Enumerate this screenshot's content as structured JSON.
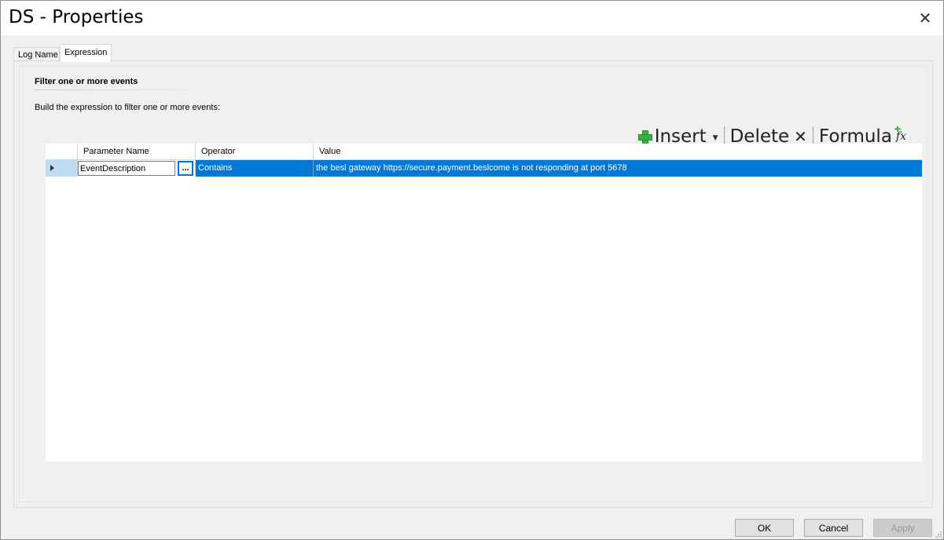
{
  "window": {
    "title": "DS - Properties",
    "close_glyph": "✕"
  },
  "tabs": [
    {
      "label": "Log Name",
      "active": false
    },
    {
      "label": "Expression",
      "active": true
    }
  ],
  "section": {
    "title": "Filter one or more events",
    "instruction": "Build the expression to filter one or more events:"
  },
  "toolbar": {
    "insert_label": "Insert",
    "delete_label": "Delete",
    "formula_label": "Formula",
    "icons": [
      "plus-icon",
      "dropdown-icon",
      "x-icon",
      "fx-icon"
    ]
  },
  "grid": {
    "columns": [
      "Parameter Name",
      "Operator",
      "Value"
    ],
    "rows": [
      {
        "parameter": "EventDescription",
        "browse_label": "...",
        "operator": "Contains",
        "value": "the besl gateway https://secure.payment.beslcome is not responding at port 5678",
        "selected": true
      }
    ]
  },
  "buttons": {
    "ok": "OK",
    "cancel": "Cancel",
    "apply": "Apply",
    "apply_enabled": false
  },
  "colors": {
    "selection": "#0078d7",
    "row_header_selected": "#bfdcf3",
    "dialog_bg": "#f0f0f0"
  }
}
